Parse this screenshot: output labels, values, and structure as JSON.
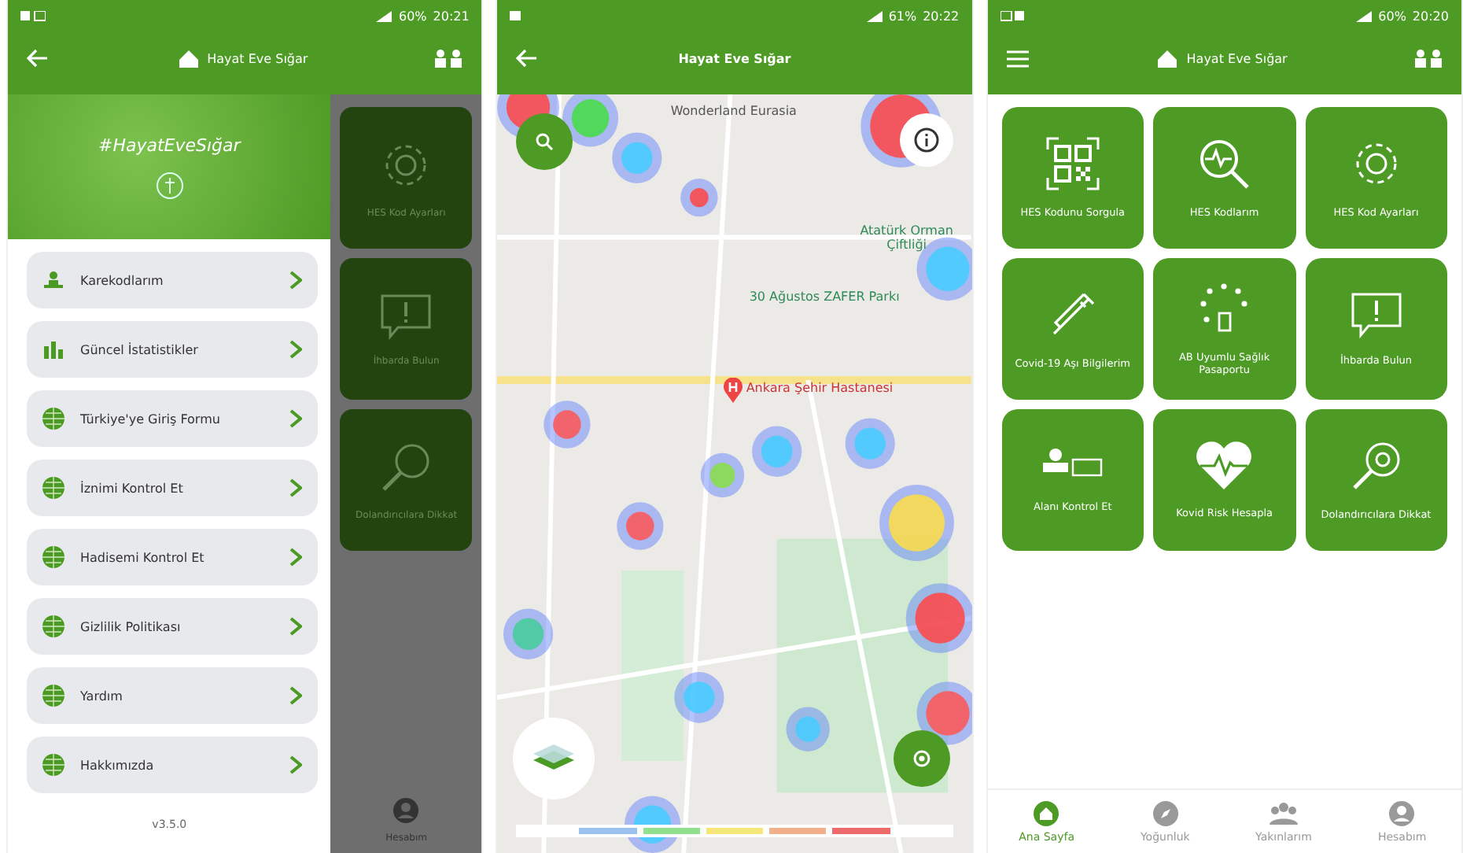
{
  "drawer_screen": {
    "status_bar": {
      "battery": "60%",
      "time": "20:21"
    },
    "app_bar": {
      "title": "Hayat Eve Sığar"
    },
    "banner": {
      "hashtag": "#HayatEveSığar"
    },
    "menu": [
      {
        "label": "Karekodlarım",
        "kind": "figure"
      },
      {
        "label": "Güncel İstatistikler",
        "kind": "chart"
      },
      {
        "label": "Türkiye'ye Giriş Formu",
        "kind": "globe"
      },
      {
        "label": "İznimi Kontrol Et",
        "kind": "globe"
      },
      {
        "label": "Hadisemi Kontrol Et",
        "kind": "globe"
      },
      {
        "label": "Gizlilik Politikası",
        "kind": "globe"
      },
      {
        "label": "Yardım",
        "kind": "globe"
      },
      {
        "label": "Hakkımızda",
        "kind": "globe"
      }
    ],
    "version": "v3.5.0",
    "behind_tiles": [
      {
        "label": "HES Kod Ayarları",
        "kind": "gear"
      },
      {
        "label": "İhbarda Bulun",
        "kind": "alert"
      },
      {
        "label": "Dolandırıcılara Dikkat",
        "kind": "magnifier"
      }
    ],
    "account_label": "Hesabım"
  },
  "map_screen": {
    "status_bar": {
      "battery": "61%",
      "time": "20:22"
    },
    "app_bar": {
      "title": "Hayat Eve Sığar"
    },
    "places": [
      {
        "label": "Wonderland Eurasia",
        "kind": "dark"
      },
      {
        "label": "Atatürk Orman Çiftliği",
        "kind": "green"
      },
      {
        "label": "30 Ağustos ZAFER Parkı",
        "kind": "green"
      },
      {
        "label": "Ankara Şehir Hastanesi",
        "kind": "hospital"
      }
    ]
  },
  "home_screen": {
    "status_bar": {
      "battery": "60%",
      "time": "20:20"
    },
    "app_bar": {
      "title": "Hayat Eve Sığar"
    },
    "tiles": [
      {
        "label": "HES Kodunu Sorgula",
        "kind": "qr"
      },
      {
        "label": "HES Kodlarım",
        "kind": "pulse"
      },
      {
        "label": "HES Kod Ayarları",
        "kind": "gear"
      },
      {
        "label": "Covid-19 Aşı Bilgilerim",
        "kind": "syringe"
      },
      {
        "label": "AB Uyumlu Sağlık Pasaportu",
        "kind": "stars"
      },
      {
        "label": "İhbarda Bulun",
        "kind": "alert"
      },
      {
        "label": "Alanı Kontrol Et",
        "kind": "area"
      },
      {
        "label": "Kovid Risk Hesapla",
        "kind": "heart"
      },
      {
        "label": "Dolandırıcılara Dikkat",
        "kind": "magnifier"
      }
    ],
    "nav": [
      {
        "label": "Ana Sayfa",
        "kind": "home",
        "selected": true
      },
      {
        "label": "Yoğunluk",
        "kind": "compass",
        "selected": false
      },
      {
        "label": "Yakınlarım",
        "kind": "people",
        "selected": false
      },
      {
        "label": "Hesabım",
        "kind": "account",
        "selected": false
      }
    ]
  }
}
